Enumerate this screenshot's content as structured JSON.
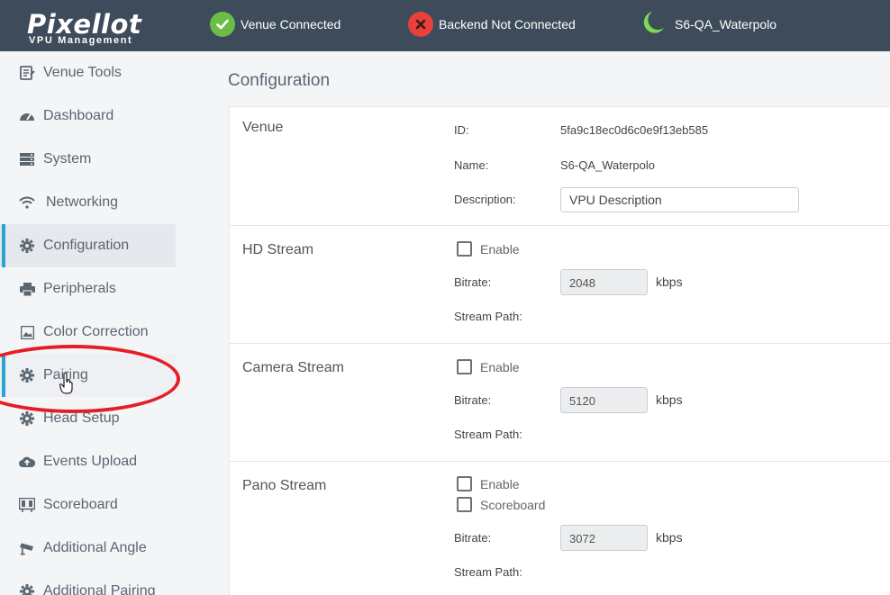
{
  "header": {
    "brand": "Pixellot",
    "brand_sub": "VPU Management",
    "venue_status": "Venue Connected",
    "backend_status": "Backend Not Connected",
    "site_name": "S6-QA_Waterpolo",
    "colors": {
      "bar": "#3d4b5b",
      "ok": "#6abd45",
      "error": "#e8413c",
      "moon": "#7ed957"
    }
  },
  "sidebar": {
    "items": [
      {
        "label": "Venue Tools",
        "icon": "venue-tools-icon"
      },
      {
        "label": "Dashboard",
        "icon": "dashboard-icon"
      },
      {
        "label": "System",
        "icon": "server-icon"
      },
      {
        "label": "Networking",
        "icon": "wifi-icon"
      },
      {
        "label": "Configuration",
        "icon": "gear-icon",
        "active": true
      },
      {
        "label": "Peripherals",
        "icon": "printer-icon"
      },
      {
        "label": "Color Correction",
        "icon": "image-icon"
      },
      {
        "label": "Pairing",
        "icon": "gear-icon"
      },
      {
        "label": "Head Setup",
        "icon": "gear-icon"
      },
      {
        "label": "Events Upload",
        "icon": "cloud-upload-icon"
      },
      {
        "label": "Scoreboard",
        "icon": "scoreboard-icon"
      },
      {
        "label": "Additional Angle",
        "icon": "camera-icon"
      },
      {
        "label": "Additional Pairing",
        "icon": "gear-icon"
      }
    ],
    "accent": "#2aa3cf"
  },
  "main": {
    "title": "Configuration",
    "venue": {
      "title": "Venue",
      "id_label": "ID:",
      "id_value": "5fa9c18ec0d6c0e9f13eb585",
      "name_label": "Name:",
      "name_value": "S6-QA_Waterpolo",
      "description_label": "Description:",
      "description_value": "VPU Description"
    },
    "hd_stream": {
      "title": "HD Stream",
      "enable_label": "Enable",
      "bitrate_label": "Bitrate:",
      "bitrate_value": "2048",
      "unit": "kbps",
      "path_label": "Stream Path:"
    },
    "camera_stream": {
      "title": "Camera Stream",
      "enable_label": "Enable",
      "bitrate_label": "Bitrate:",
      "bitrate_value": "5120",
      "unit": "kbps",
      "path_label": "Stream Path:"
    },
    "pano_stream": {
      "title": "Pano Stream",
      "enable_label": "Enable",
      "scoreboard_label": "Scoreboard",
      "bitrate_label": "Bitrate:",
      "bitrate_value": "3072",
      "unit": "kbps",
      "path_label": "Stream Path:"
    }
  }
}
